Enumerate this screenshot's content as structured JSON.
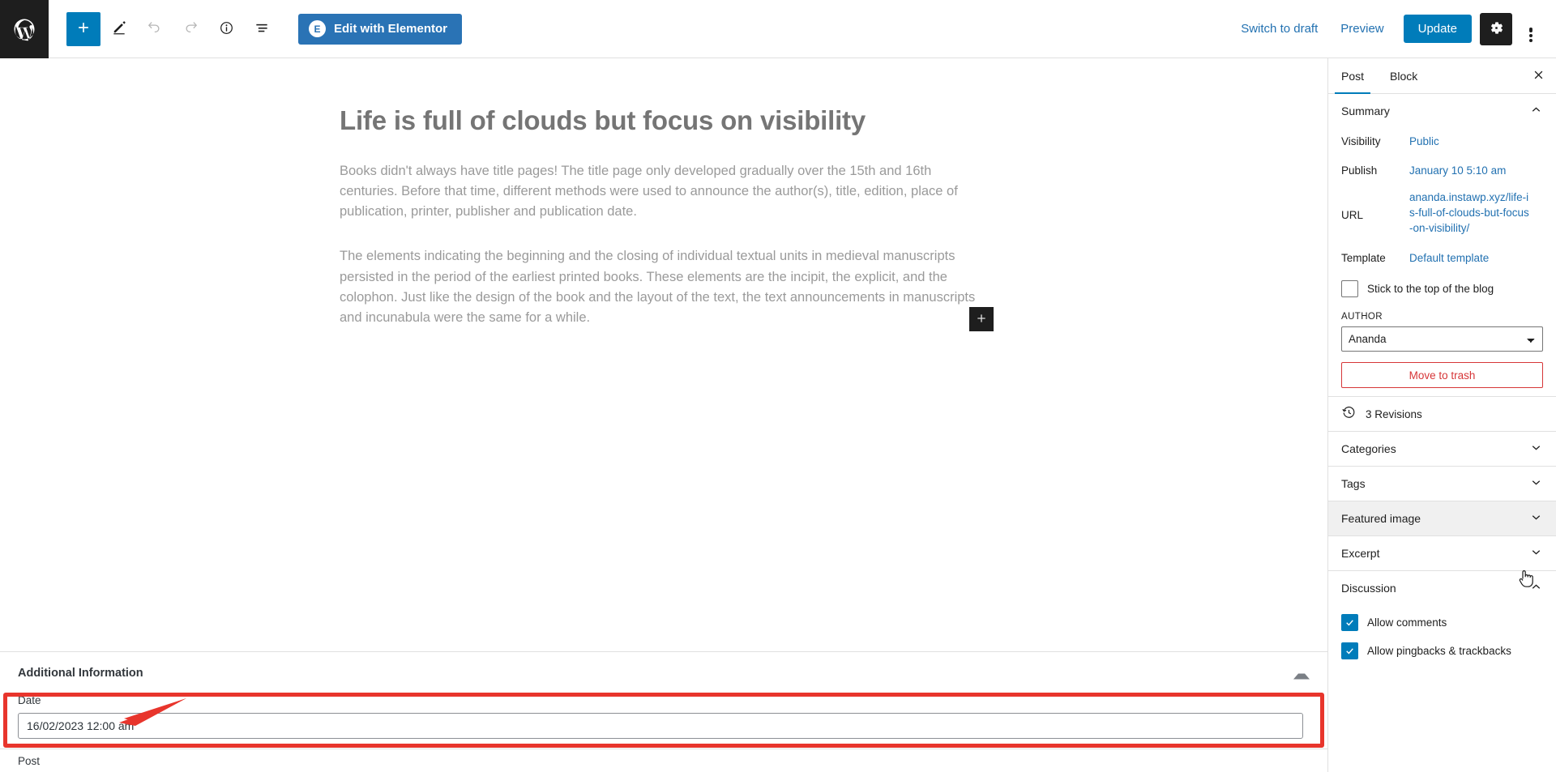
{
  "topbar": {
    "logo_icon": "wordpress-logo-icon",
    "tools": [
      {
        "name": "add-block-button",
        "icon": "plus-icon",
        "label": "Add block",
        "state": "primary"
      },
      {
        "name": "tools-button",
        "icon": "pencil-icon",
        "label": "Tools",
        "state": "default"
      },
      {
        "name": "undo-button",
        "icon": "undo-arrow-icon",
        "label": "Undo",
        "state": "disabled"
      },
      {
        "name": "redo-button",
        "icon": "redo-arrow-icon",
        "label": "Redo",
        "state": "disabled"
      },
      {
        "name": "details-button",
        "icon": "info-circle-icon",
        "label": "Details",
        "state": "default"
      },
      {
        "name": "list-view-button",
        "icon": "list-view-icon",
        "label": "List View",
        "state": "default"
      }
    ],
    "elementor_button": {
      "badge": "E",
      "label": "Edit with Elementor"
    },
    "switch_to_draft": "Switch to draft",
    "preview": "Preview",
    "update": "Update",
    "settings_icon": "gear-icon",
    "options_icon": "kebab-menu-icon",
    "accent_blue": "#007cba",
    "elementor_blue": "#2a73b5"
  },
  "editor": {
    "title": "Life is full of clouds but focus on visibility",
    "paragraphs": [
      "Books didn't always have title pages! The title page only developed gradually over the 15th and 16th centuries. Before that time, different methods were used to announce the author(s), title, edition, place of publication, printer, publisher and publication date.",
      "The elements indicating the beginning and the closing of individual textual units in medieval manuscripts persisted in the period of the earliest printed books. These elements are the incipit, the explicit, and the colophon. Just like the design of the book and the layout of the text, the text announcements in manuscripts and incunabula were the same for a while."
    ],
    "inserter_icon": "plus-icon"
  },
  "meta_panel": {
    "title": "Additional Information",
    "collapse_icon": "caret-up-icon",
    "date_label": "Date",
    "date_value": "16/02/2023 12:00 am",
    "footer_label": "Post"
  },
  "sidebar": {
    "tabs": [
      {
        "label": "Post",
        "active": true
      },
      {
        "label": "Block",
        "active": false
      }
    ],
    "close_icon": "close-icon",
    "summary": {
      "heading": "Summary",
      "chevron": "chevron-up-icon",
      "rows": [
        {
          "label": "Visibility",
          "value": "Public"
        },
        {
          "label": "Publish",
          "value": "January 10 5:10 am"
        },
        {
          "label": "URL",
          "value": "ananda.instawp.xyz/life-is-full-of-clouds-but-focus-on-visibility/"
        },
        {
          "label": "Template",
          "value": "Default template"
        }
      ],
      "sticky_label": "Stick to the top of the blog",
      "sticky_checked": false,
      "author_label": "AUTHOR",
      "author_value": "Ananda",
      "trash_label": "Move to trash"
    },
    "revisions": {
      "icon": "revisions-clock-icon",
      "label": "3 Revisions"
    },
    "panels": [
      {
        "name": "categories",
        "label": "Categories",
        "chevron": "chevron-down-icon",
        "hovered": false
      },
      {
        "name": "tags",
        "label": "Tags",
        "chevron": "chevron-down-icon",
        "hovered": false
      },
      {
        "name": "featured-image",
        "label": "Featured image",
        "chevron": "chevron-down-icon",
        "hovered": true
      },
      {
        "name": "excerpt",
        "label": "Excerpt",
        "chevron": "chevron-down-icon",
        "hovered": false
      }
    ],
    "discussion": {
      "heading": "Discussion",
      "chevron": "chevron-up-icon",
      "options": [
        {
          "label": "Allow comments",
          "checked": true
        },
        {
          "label": "Allow pingbacks & trackbacks",
          "checked": true
        }
      ]
    }
  },
  "annotations": {
    "highlight_color": "#e8352c",
    "arrow_color": "#e8352c",
    "target": "date-field"
  }
}
